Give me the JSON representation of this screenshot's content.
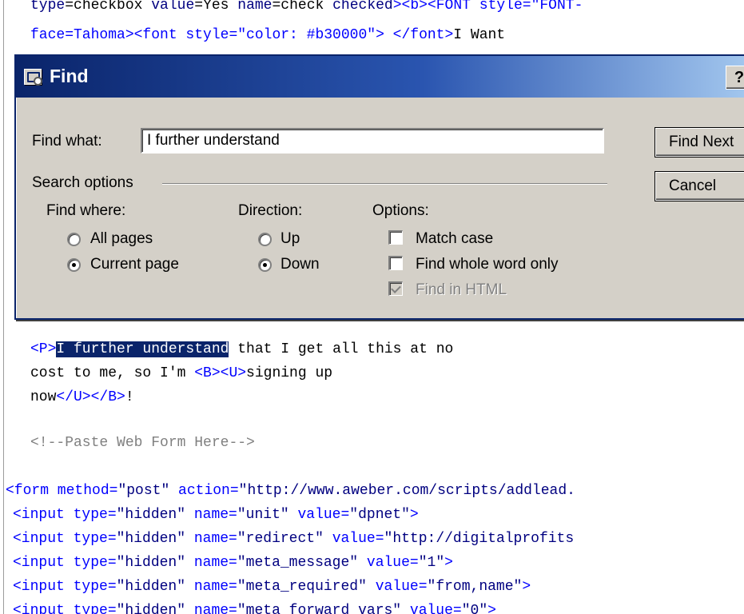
{
  "editor": {
    "lines": [
      {
        "segments": [
          {
            "t": "type",
            "c": "attr"
          },
          {
            "t": "=checkbox ",
            "c": "text"
          },
          {
            "t": "value",
            "c": "attr"
          },
          {
            "t": "=Yes ",
            "c": "text"
          },
          {
            "t": "name",
            "c": "attr"
          },
          {
            "t": "=check ",
            "c": "text"
          },
          {
            "t": "checked",
            "c": "attr"
          },
          {
            "t": "><b><FONT style=\"FONT-",
            "c": "tag"
          }
        ]
      },
      {
        "segments": [
          {
            "t": "face=Tahoma><font style=\"color: #b30000\"> </font>",
            "c": "tag"
          },
          {
            "t": "I Want",
            "c": "text"
          }
        ]
      },
      {
        "segments": [
          {
            "t": "<P>",
            "c": "tag"
          },
          {
            "t": "I further understand",
            "c": "hl"
          },
          {
            "t": " that I get all this at no",
            "c": "text"
          }
        ]
      },
      {
        "segments": [
          {
            "t": "cost to me, so I'm ",
            "c": "text"
          },
          {
            "t": "<B><U>",
            "c": "tag"
          },
          {
            "t": "signing up",
            "c": "text"
          }
        ]
      },
      {
        "segments": [
          {
            "t": "now",
            "c": "text"
          },
          {
            "t": "</U></B>",
            "c": "tag"
          },
          {
            "t": "!",
            "c": "text"
          }
        ]
      },
      {
        "segments": [
          {
            "t": "<!--Paste Web Form Here-->",
            "c": "comment"
          }
        ]
      },
      {
        "segments": [
          {
            "t": "<form method=",
            "c": "tag"
          },
          {
            "t": "\"post\"",
            "c": "val"
          },
          {
            "t": " action=",
            "c": "tag"
          },
          {
            "t": "\"http://www.aweber.com/scripts/addlead.",
            "c": "val"
          }
        ]
      },
      {
        "segments": [
          {
            "t": "<input type=",
            "c": "tag"
          },
          {
            "t": "\"hidden\"",
            "c": "val"
          },
          {
            "t": " name=",
            "c": "tag"
          },
          {
            "t": "\"unit\"",
            "c": "val"
          },
          {
            "t": " value=",
            "c": "tag"
          },
          {
            "t": "\"dpnet\"",
            "c": "val"
          },
          {
            "t": ">",
            "c": "tag"
          }
        ]
      },
      {
        "segments": [
          {
            "t": "<input type=",
            "c": "tag"
          },
          {
            "t": "\"hidden\"",
            "c": "val"
          },
          {
            "t": " name=",
            "c": "tag"
          },
          {
            "t": "\"redirect\"",
            "c": "val"
          },
          {
            "t": " value=",
            "c": "tag"
          },
          {
            "t": "\"http://digitalprofits",
            "c": "val"
          }
        ]
      },
      {
        "segments": [
          {
            "t": "<input type=",
            "c": "tag"
          },
          {
            "t": "\"hidden\"",
            "c": "val"
          },
          {
            "t": " name=",
            "c": "tag"
          },
          {
            "t": "\"meta_message\"",
            "c": "val"
          },
          {
            "t": " value=",
            "c": "tag"
          },
          {
            "t": "\"1\"",
            "c": "val"
          },
          {
            "t": ">",
            "c": "tag"
          }
        ]
      },
      {
        "segments": [
          {
            "t": "<input type=",
            "c": "tag"
          },
          {
            "t": "\"hidden\"",
            "c": "val"
          },
          {
            "t": " name=",
            "c": "tag"
          },
          {
            "t": "\"meta_required\"",
            "c": "val"
          },
          {
            "t": " value=",
            "c": "tag"
          },
          {
            "t": "\"from,name\"",
            "c": "val"
          },
          {
            "t": ">",
            "c": "tag"
          }
        ]
      },
      {
        "segments": [
          {
            "t": "<input type=",
            "c": "tag"
          },
          {
            "t": "\"hidden\"",
            "c": "val"
          },
          {
            "t": " name=",
            "c": "tag"
          },
          {
            "t": "\"meta_forward_vars\"",
            "c": "val"
          },
          {
            "t": " value=",
            "c": "tag"
          },
          {
            "t": "\"0\"",
            "c": "val"
          },
          {
            "t": ">",
            "c": "tag"
          }
        ]
      }
    ]
  },
  "dialog": {
    "title": "Find",
    "help_label": "?",
    "find_what_label": "Find what:",
    "find_what_value": "I further understand",
    "search_options_label": "Search options",
    "find_where_label": "Find where:",
    "find_where_options": [
      "All pages",
      "Current page"
    ],
    "find_where_selected": "Current page",
    "direction_label": "Direction:",
    "direction_options": [
      "Up",
      "Down"
    ],
    "direction_selected": "Down",
    "options_label": "Options:",
    "options": [
      {
        "label": "Match case",
        "checked": false,
        "disabled": false
      },
      {
        "label": "Find whole word only",
        "checked": false,
        "disabled": false
      },
      {
        "label": "Find in HTML",
        "checked": true,
        "disabled": true
      }
    ],
    "find_next_label": "Find Next",
    "cancel_label": "Cancel"
  },
  "colors": {
    "title_gradient_start": "#0a246a",
    "title_gradient_end": "#a6caf0",
    "dialog_face": "#d4d0c8",
    "selection": "#0a246a",
    "tag": "#0000ff",
    "comment": "#808080"
  }
}
